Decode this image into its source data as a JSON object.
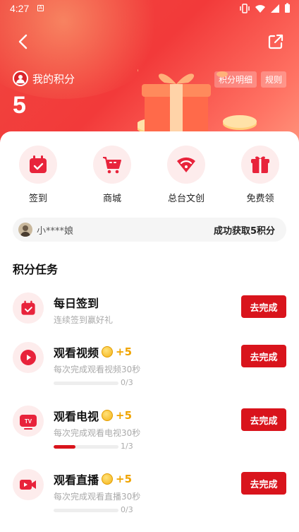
{
  "status_bar": {
    "time": "4:27"
  },
  "header": {
    "my_points_label": "我的积分",
    "points_value": "5",
    "links": [
      "积分明细",
      "规则"
    ]
  },
  "quick_actions": [
    {
      "label": "签到",
      "icon": "calendar-check-icon"
    },
    {
      "label": "商城",
      "icon": "shopping-cart-icon"
    },
    {
      "label": "总台文创",
      "icon": "fan-icon"
    },
    {
      "label": "免费领",
      "icon": "gift-icon"
    }
  ],
  "ticker": {
    "user": "小****娘",
    "message": "成功获取5积分"
  },
  "tasks_section": {
    "title": "积分任务",
    "tasks": [
      {
        "title": "每日签到",
        "reward": "",
        "desc": "连续签到赢好礼",
        "progress": "",
        "progress_fraction": null,
        "button": "去完成",
        "icon": "calendar-check-icon"
      },
      {
        "title": "观看视频",
        "reward": "+5",
        "desc": "每次完成观看视频30秒",
        "progress": "0/3",
        "progress_fraction": 0,
        "button": "去完成",
        "icon": "play-icon"
      },
      {
        "title": "观看电视",
        "reward": "+5",
        "desc": "每次完成观看电视30秒",
        "progress": "1/3",
        "progress_fraction": 0.333,
        "button": "去完成",
        "icon": "tv-icon"
      },
      {
        "title": "观看直播",
        "reward": "+5",
        "desc": "每次完成观看直播30秒",
        "progress": "0/3",
        "progress_fraction": 0,
        "button": "去完成",
        "icon": "live-camera-icon"
      }
    ]
  },
  "colors": {
    "brand_red": "#d9141c",
    "header_red": "#f23a3a",
    "coin_gold": "#f0a400"
  }
}
